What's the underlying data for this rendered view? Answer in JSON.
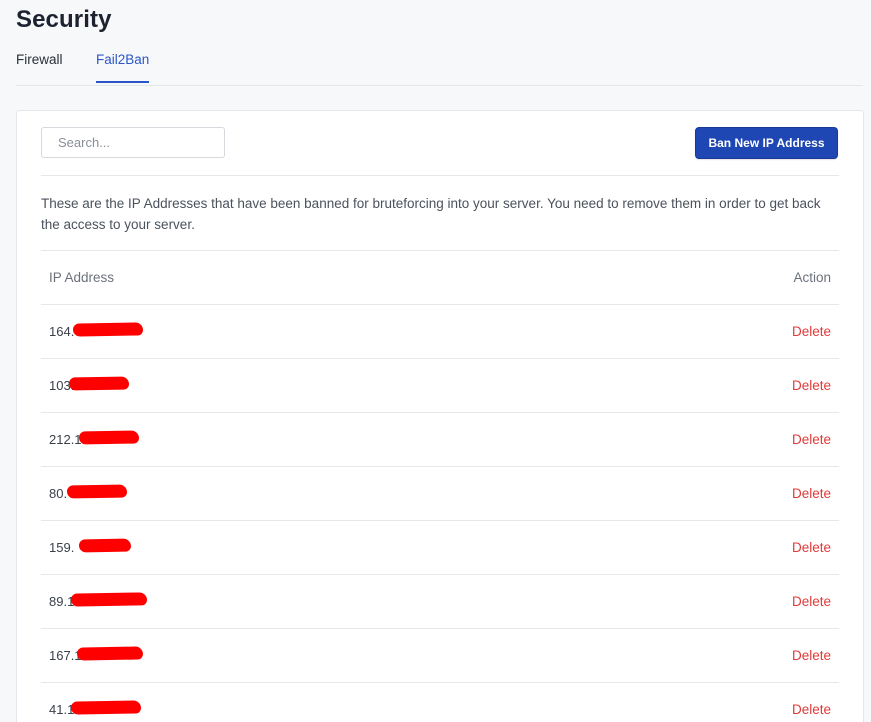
{
  "page": {
    "title": "Security"
  },
  "tabs": [
    {
      "label": "Firewall",
      "active": false
    },
    {
      "label": "Fail2Ban",
      "active": true
    }
  ],
  "toolbar": {
    "search_placeholder": "Search...",
    "ban_button_label": "Ban New IP Address"
  },
  "description": "These are the IP Addresses that have been banned for bruteforcing into your server. You need to remove them in order to get back the access to your server.",
  "table": {
    "columns": [
      "IP Address",
      "Action"
    ],
    "rows": [
      {
        "ip_visible": "164.",
        "action": "Delete"
      },
      {
        "ip_visible": "103.",
        "action": "Delete"
      },
      {
        "ip_visible": "212.1",
        "action": "Delete"
      },
      {
        "ip_visible": "80.",
        "action": "Delete"
      },
      {
        "ip_visible": "159.",
        "action": "Delete"
      },
      {
        "ip_visible": "89.1",
        "action": "Delete"
      },
      {
        "ip_visible": "167.1",
        "action": "Delete"
      },
      {
        "ip_visible": "41.1",
        "action": "Delete"
      }
    ]
  },
  "colors": {
    "accent": "#2b56c9",
    "primary_button": "#1f47b3",
    "danger": "#e03a3a",
    "redaction": "#ff0000"
  }
}
